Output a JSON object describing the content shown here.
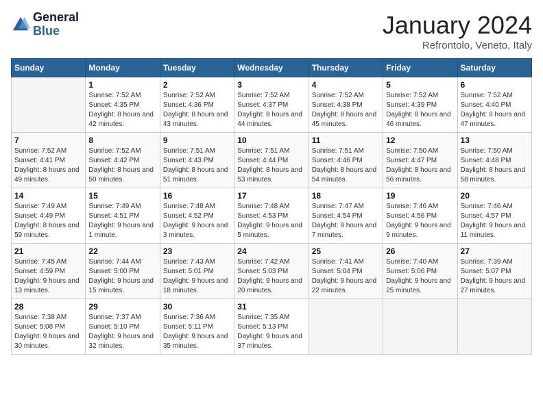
{
  "header": {
    "logo_line1": "General",
    "logo_line2": "Blue",
    "month_title": "January 2024",
    "location": "Refrontolo, Veneto, Italy"
  },
  "days_of_week": [
    "Sunday",
    "Monday",
    "Tuesday",
    "Wednesday",
    "Thursday",
    "Friday",
    "Saturday"
  ],
  "weeks": [
    [
      {
        "day": "",
        "sunrise": "",
        "sunset": "",
        "daylight": ""
      },
      {
        "day": "1",
        "sunrise": "Sunrise: 7:52 AM",
        "sunset": "Sunset: 4:35 PM",
        "daylight": "Daylight: 8 hours and 42 minutes."
      },
      {
        "day": "2",
        "sunrise": "Sunrise: 7:52 AM",
        "sunset": "Sunset: 4:36 PM",
        "daylight": "Daylight: 8 hours and 43 minutes."
      },
      {
        "day": "3",
        "sunrise": "Sunrise: 7:52 AM",
        "sunset": "Sunset: 4:37 PM",
        "daylight": "Daylight: 8 hours and 44 minutes."
      },
      {
        "day": "4",
        "sunrise": "Sunrise: 7:52 AM",
        "sunset": "Sunset: 4:38 PM",
        "daylight": "Daylight: 8 hours and 45 minutes."
      },
      {
        "day": "5",
        "sunrise": "Sunrise: 7:52 AM",
        "sunset": "Sunset: 4:39 PM",
        "daylight": "Daylight: 8 hours and 46 minutes."
      },
      {
        "day": "6",
        "sunrise": "Sunrise: 7:52 AM",
        "sunset": "Sunset: 4:40 PM",
        "daylight": "Daylight: 8 hours and 47 minutes."
      }
    ],
    [
      {
        "day": "7",
        "sunrise": "Sunrise: 7:52 AM",
        "sunset": "Sunset: 4:41 PM",
        "daylight": "Daylight: 8 hours and 49 minutes."
      },
      {
        "day": "8",
        "sunrise": "Sunrise: 7:52 AM",
        "sunset": "Sunset: 4:42 PM",
        "daylight": "Daylight: 8 hours and 50 minutes."
      },
      {
        "day": "9",
        "sunrise": "Sunrise: 7:51 AM",
        "sunset": "Sunset: 4:43 PM",
        "daylight": "Daylight: 8 hours and 51 minutes."
      },
      {
        "day": "10",
        "sunrise": "Sunrise: 7:51 AM",
        "sunset": "Sunset: 4:44 PM",
        "daylight": "Daylight: 8 hours and 53 minutes."
      },
      {
        "day": "11",
        "sunrise": "Sunrise: 7:51 AM",
        "sunset": "Sunset: 4:46 PM",
        "daylight": "Daylight: 8 hours and 54 minutes."
      },
      {
        "day": "12",
        "sunrise": "Sunrise: 7:50 AM",
        "sunset": "Sunset: 4:47 PM",
        "daylight": "Daylight: 8 hours and 56 minutes."
      },
      {
        "day": "13",
        "sunrise": "Sunrise: 7:50 AM",
        "sunset": "Sunset: 4:48 PM",
        "daylight": "Daylight: 8 hours and 58 minutes."
      }
    ],
    [
      {
        "day": "14",
        "sunrise": "Sunrise: 7:49 AM",
        "sunset": "Sunset: 4:49 PM",
        "daylight": "Daylight: 8 hours and 59 minutes."
      },
      {
        "day": "15",
        "sunrise": "Sunrise: 7:49 AM",
        "sunset": "Sunset: 4:51 PM",
        "daylight": "Daylight: 9 hours and 1 minute."
      },
      {
        "day": "16",
        "sunrise": "Sunrise: 7:48 AM",
        "sunset": "Sunset: 4:52 PM",
        "daylight": "Daylight: 9 hours and 3 minutes."
      },
      {
        "day": "17",
        "sunrise": "Sunrise: 7:48 AM",
        "sunset": "Sunset: 4:53 PM",
        "daylight": "Daylight: 9 hours and 5 minutes."
      },
      {
        "day": "18",
        "sunrise": "Sunrise: 7:47 AM",
        "sunset": "Sunset: 4:54 PM",
        "daylight": "Daylight: 9 hours and 7 minutes."
      },
      {
        "day": "19",
        "sunrise": "Sunrise: 7:46 AM",
        "sunset": "Sunset: 4:56 PM",
        "daylight": "Daylight: 9 hours and 9 minutes."
      },
      {
        "day": "20",
        "sunrise": "Sunrise: 7:46 AM",
        "sunset": "Sunset: 4:57 PM",
        "daylight": "Daylight: 9 hours and 11 minutes."
      }
    ],
    [
      {
        "day": "21",
        "sunrise": "Sunrise: 7:45 AM",
        "sunset": "Sunset: 4:59 PM",
        "daylight": "Daylight: 9 hours and 13 minutes."
      },
      {
        "day": "22",
        "sunrise": "Sunrise: 7:44 AM",
        "sunset": "Sunset: 5:00 PM",
        "daylight": "Daylight: 9 hours and 15 minutes."
      },
      {
        "day": "23",
        "sunrise": "Sunrise: 7:43 AM",
        "sunset": "Sunset: 5:01 PM",
        "daylight": "Daylight: 9 hours and 18 minutes."
      },
      {
        "day": "24",
        "sunrise": "Sunrise: 7:42 AM",
        "sunset": "Sunset: 5:03 PM",
        "daylight": "Daylight: 9 hours and 20 minutes."
      },
      {
        "day": "25",
        "sunrise": "Sunrise: 7:41 AM",
        "sunset": "Sunset: 5:04 PM",
        "daylight": "Daylight: 9 hours and 22 minutes."
      },
      {
        "day": "26",
        "sunrise": "Sunrise: 7:40 AM",
        "sunset": "Sunset: 5:06 PM",
        "daylight": "Daylight: 9 hours and 25 minutes."
      },
      {
        "day": "27",
        "sunrise": "Sunrise: 7:39 AM",
        "sunset": "Sunset: 5:07 PM",
        "daylight": "Daylight: 9 hours and 27 minutes."
      }
    ],
    [
      {
        "day": "28",
        "sunrise": "Sunrise: 7:38 AM",
        "sunset": "Sunset: 5:08 PM",
        "daylight": "Daylight: 9 hours and 30 minutes."
      },
      {
        "day": "29",
        "sunrise": "Sunrise: 7:37 AM",
        "sunset": "Sunset: 5:10 PM",
        "daylight": "Daylight: 9 hours and 32 minutes."
      },
      {
        "day": "30",
        "sunrise": "Sunrise: 7:36 AM",
        "sunset": "Sunset: 5:11 PM",
        "daylight": "Daylight: 9 hours and 35 minutes."
      },
      {
        "day": "31",
        "sunrise": "Sunrise: 7:35 AM",
        "sunset": "Sunset: 5:13 PM",
        "daylight": "Daylight: 9 hours and 37 minutes."
      },
      {
        "day": "",
        "sunrise": "",
        "sunset": "",
        "daylight": ""
      },
      {
        "day": "",
        "sunrise": "",
        "sunset": "",
        "daylight": ""
      },
      {
        "day": "",
        "sunrise": "",
        "sunset": "",
        "daylight": ""
      }
    ]
  ]
}
